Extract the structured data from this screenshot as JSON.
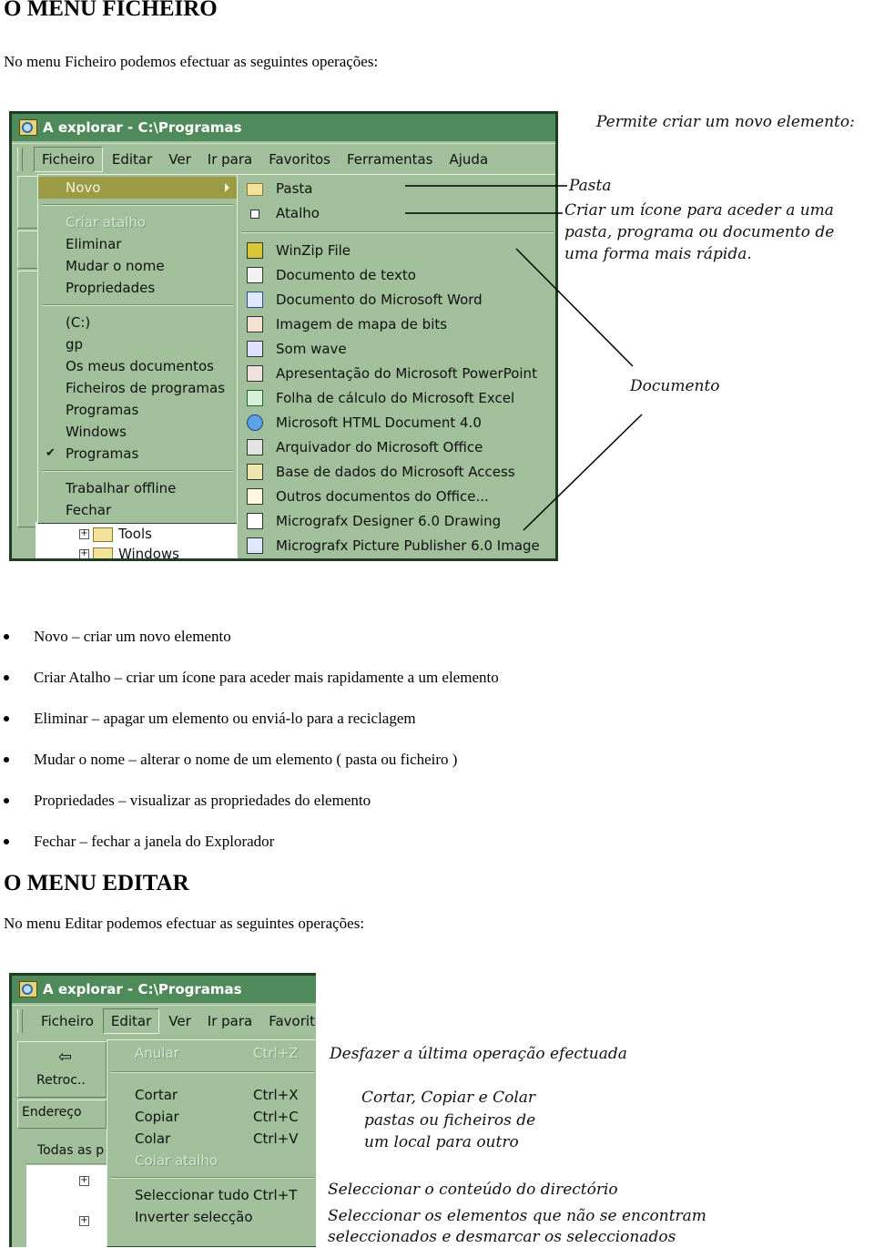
{
  "section1": {
    "heading": "O MENU FICHEIRO",
    "intro": "No menu Ficheiro podemos efectuar as seguintes operações:",
    "window": {
      "title": "A explorar - C:\\Programas",
      "menubar": [
        "Ficheiro",
        "Editar",
        "Ver",
        "Ir para",
        "Favoritos",
        "Ferramentas",
        "Ajuda"
      ],
      "active_menu": "Ficheiro",
      "file_menu": {
        "highlighted": "Novo",
        "group1": [
          "Novo"
        ],
        "group2": [
          {
            "label": "Criar atalho",
            "disabled": true
          },
          {
            "label": "Eliminar"
          },
          {
            "label": "Mudar o nome"
          },
          {
            "label": "Propriedades"
          }
        ],
        "group3": [
          "(C:)",
          "gp",
          "Os meus documentos",
          "Ficheiros de programas",
          "Programas",
          "Windows",
          "Programas"
        ],
        "checked_item": "Programas",
        "group4": [
          "Trabalhar offline",
          "Fechar"
        ]
      },
      "new_submenu": {
        "group1": [
          {
            "label": "Pasta",
            "icon": "folder-icon"
          },
          {
            "label": "Atalho",
            "icon": "shortcut-icon"
          }
        ],
        "group2": [
          {
            "label": "WinZip File",
            "icon": "winzip-icon"
          },
          {
            "label": "Documento de texto",
            "icon": "text-document-icon"
          },
          {
            "label": "Documento do Microsoft Word",
            "icon": "word-icon"
          },
          {
            "label": "Imagem de mapa de bits",
            "icon": "bitmap-icon"
          },
          {
            "label": "Som wave",
            "icon": "sound-icon"
          },
          {
            "label": "Apresentação do Microsoft PowerPoint",
            "icon": "powerpoint-icon"
          },
          {
            "label": "Folha de cálculo do Microsoft Excel",
            "icon": "excel-icon"
          },
          {
            "label": "Microsoft HTML Document 4.0",
            "icon": "html-icon"
          },
          {
            "label": "Arquivador do Microsoft Office",
            "icon": "binder-icon"
          },
          {
            "label": "Base de dados do Microsoft Access",
            "icon": "access-icon"
          },
          {
            "label": "Outros documentos do Office...",
            "icon": "office-icon"
          },
          {
            "label": "Micrografx Designer 6.0 Drawing",
            "icon": "designer-icon"
          },
          {
            "label": "Micrografx Picture Publisher 6.0 Image",
            "icon": "publisher-icon"
          }
        ]
      },
      "tree": [
        "Tools",
        "Windows"
      ]
    },
    "annotations": {
      "new_element": "Permite criar um novo elemento:",
      "pasta": "Pasta",
      "atalho_lines": [
        "Criar um ícone para aceder a uma",
        "pasta, programa ou documento de",
        "uma forma mais rápida."
      ],
      "documento": "Documento"
    },
    "bullets": [
      "Novo – criar um novo elemento",
      "Criar Atalho – criar um ícone para aceder mais rapidamente a um elemento",
      "Eliminar – apagar um elemento ou enviá-lo para a reciclagem",
      "Mudar o nome – alterar o nome de um elemento ( pasta ou ficheiro )",
      "Propriedades – visualizar as propriedades do elemento",
      "Fechar – fechar a janela do Explorador"
    ]
  },
  "section2": {
    "heading": "O MENU EDITAR",
    "intro": "No menu Editar podemos efectuar as seguintes operações:",
    "window": {
      "title": "A explorar - C:\\Programas",
      "menubar": [
        "Ficheiro",
        "Editar",
        "Ver",
        "Ir para",
        "Favorito"
      ],
      "active_menu": "Editar",
      "toolbar_back": "Retroc..",
      "address_label": "Endereço",
      "panel_label": "Todas as p",
      "edit_menu": {
        "undo": {
          "label": "Anular",
          "shortcut": "Ctrl+Z",
          "disabled": true
        },
        "clipboard": [
          {
            "label": "Cortar",
            "shortcut": "Ctrl+X"
          },
          {
            "label": "Copiar",
            "shortcut": "Ctrl+C"
          },
          {
            "label": "Colar",
            "shortcut": "Ctrl+V"
          },
          {
            "label": "Colar atalho",
            "shortcut": "",
            "disabled": true
          }
        ],
        "selection": [
          {
            "label": "Seleccionar tudo",
            "shortcut": "Ctrl+T"
          },
          {
            "label": "Inverter selecção",
            "shortcut": ""
          }
        ]
      }
    },
    "annotations": {
      "undo": "Desfazer a última operação efectuada",
      "clipboard_lines": [
        "Cortar, Copiar e Colar",
        "pastas ou ficheiros de",
        "um local para outro"
      ],
      "select_all": "Seleccionar o conteúdo do directório",
      "invert_lines": [
        "Seleccionar os elementos que não se encontram",
        "seleccionados e desmarcar os seleccionados"
      ]
    }
  }
}
